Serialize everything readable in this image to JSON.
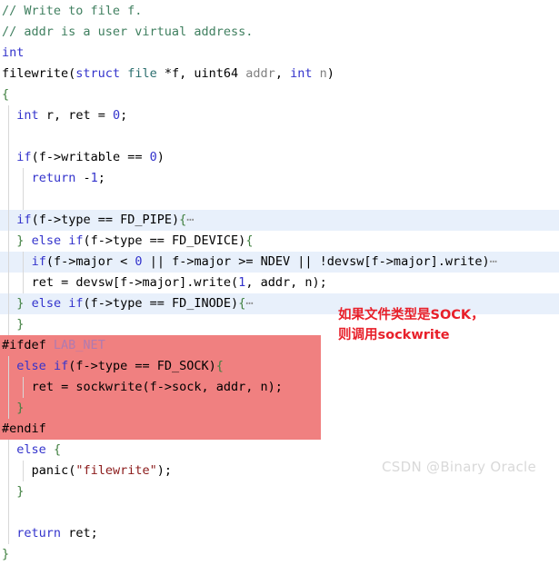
{
  "editor": {
    "language": "c",
    "background": "#ffffff",
    "highlight_row_color": "#e8f0fb",
    "block_highlight_color": "#f08080",
    "lines": [
      {
        "indent": 0,
        "highlight": "none",
        "guides": 0,
        "tokens": [
          {
            "t": "// Write to file f.",
            "c": "t-comment"
          }
        ]
      },
      {
        "indent": 0,
        "highlight": "none",
        "guides": 0,
        "tokens": [
          {
            "t": "// addr is a user virtual address.",
            "c": "t-comment"
          }
        ]
      },
      {
        "indent": 0,
        "highlight": "none",
        "guides": 0,
        "tokens": [
          {
            "t": "int",
            "c": "t-kw"
          }
        ]
      },
      {
        "indent": 0,
        "highlight": "none",
        "guides": 0,
        "tokens": [
          {
            "t": "filewrite",
            "c": "t-plain"
          },
          {
            "t": "(",
            "c": "t-punc"
          },
          {
            "t": "struct",
            "c": "t-kw"
          },
          {
            "t": " ",
            "c": "t-plain"
          },
          {
            "t": "file",
            "c": "t-type"
          },
          {
            "t": " *f, ",
            "c": "t-plain"
          },
          {
            "t": "uint64",
            "c": "t-plain"
          },
          {
            "t": " ",
            "c": "t-plain"
          },
          {
            "t": "addr",
            "c": "t-param"
          },
          {
            "t": ", ",
            "c": "t-plain"
          },
          {
            "t": "int",
            "c": "t-kw"
          },
          {
            "t": " ",
            "c": "t-plain"
          },
          {
            "t": "n",
            "c": "t-param"
          },
          {
            "t": ")",
            "c": "t-punc"
          }
        ]
      },
      {
        "indent": 0,
        "highlight": "none",
        "guides": 0,
        "tokens": [
          {
            "t": "{",
            "c": "t-brace"
          }
        ]
      },
      {
        "indent": 1,
        "highlight": "none",
        "guides": 1,
        "tokens": [
          {
            "t": "int",
            "c": "t-kw"
          },
          {
            "t": " r, ret = ",
            "c": "t-plain"
          },
          {
            "t": "0",
            "c": "t-num"
          },
          {
            "t": ";",
            "c": "t-plain"
          }
        ]
      },
      {
        "indent": 1,
        "highlight": "none",
        "guides": 1,
        "tokens": []
      },
      {
        "indent": 1,
        "highlight": "none",
        "guides": 1,
        "tokens": [
          {
            "t": "if",
            "c": "t-kw"
          },
          {
            "t": "(f->writable == ",
            "c": "t-plain"
          },
          {
            "t": "0",
            "c": "t-num"
          },
          {
            "t": ")",
            "c": "t-plain"
          }
        ]
      },
      {
        "indent": 2,
        "highlight": "none",
        "guides": 2,
        "tokens": [
          {
            "t": "return",
            "c": "t-kw"
          },
          {
            "t": " -",
            "c": "t-plain"
          },
          {
            "t": "1",
            "c": "t-num"
          },
          {
            "t": ";",
            "c": "t-plain"
          }
        ]
      },
      {
        "indent": 1,
        "highlight": "none",
        "guides": 2,
        "tokens": []
      },
      {
        "indent": 1,
        "highlight": "blue",
        "guides": 1,
        "tokens": [
          {
            "t": "if",
            "c": "t-kw"
          },
          {
            "t": "(f->type == FD_PIPE)",
            "c": "t-plain"
          },
          {
            "t": "{",
            "c": "t-brace"
          },
          {
            "t": "⋯",
            "c": "t-fold"
          }
        ]
      },
      {
        "indent": 1,
        "highlight": "none",
        "guides": 1,
        "tokens": [
          {
            "t": "}",
            "c": "t-brace"
          },
          {
            "t": " ",
            "c": "t-plain"
          },
          {
            "t": "else",
            "c": "t-kw"
          },
          {
            "t": " ",
            "c": "t-plain"
          },
          {
            "t": "if",
            "c": "t-kw"
          },
          {
            "t": "(f->type == FD_DEVICE)",
            "c": "t-plain"
          },
          {
            "t": "{",
            "c": "t-brace"
          }
        ]
      },
      {
        "indent": 2,
        "highlight": "blue",
        "guides": 2,
        "tokens": [
          {
            "t": "if",
            "c": "t-kw"
          },
          {
            "t": "(f->major < ",
            "c": "t-plain"
          },
          {
            "t": "0",
            "c": "t-num"
          },
          {
            "t": " ",
            "c": "t-plain"
          },
          {
            "t": "||",
            "c": "t-plain"
          },
          {
            "t": " f->major >= NDEV ",
            "c": "t-plain"
          },
          {
            "t": "||",
            "c": "t-plain"
          },
          {
            "t": " !devsw[f->major].write)",
            "c": "t-plain"
          },
          {
            "t": "⋯",
            "c": "t-fold"
          }
        ]
      },
      {
        "indent": 2,
        "highlight": "none",
        "guides": 2,
        "tokens": [
          {
            "t": "ret = devsw[f->major].write(",
            "c": "t-plain"
          },
          {
            "t": "1",
            "c": "t-num"
          },
          {
            "t": ", ",
            "c": "t-plain"
          },
          {
            "t": "addr",
            "c": "t-plain"
          },
          {
            "t": ", n);",
            "c": "t-plain"
          }
        ]
      },
      {
        "indent": 1,
        "highlight": "blue",
        "guides": 1,
        "tokens": [
          {
            "t": "}",
            "c": "t-brace"
          },
          {
            "t": " ",
            "c": "t-plain"
          },
          {
            "t": "else",
            "c": "t-kw"
          },
          {
            "t": " ",
            "c": "t-plain"
          },
          {
            "t": "if",
            "c": "t-kw"
          },
          {
            "t": "(f->type == FD_INODE)",
            "c": "t-plain"
          },
          {
            "t": "{",
            "c": "t-brace"
          },
          {
            "t": "⋯",
            "c": "t-fold"
          }
        ]
      },
      {
        "indent": 1,
        "highlight": "none",
        "guides": 1,
        "tokens": [
          {
            "t": "}",
            "c": "t-brace"
          }
        ]
      },
      {
        "indent": 0,
        "highlight": "pink",
        "guides": 0,
        "tokens": [
          {
            "t": "#ifdef",
            "c": "t-macro"
          },
          {
            "t": " ",
            "c": "t-plain"
          },
          {
            "t": "LAB_NET",
            "c": "t-macroid"
          }
        ]
      },
      {
        "indent": 1,
        "highlight": "pink",
        "guides": 1,
        "tokens": [
          {
            "t": "else",
            "c": "t-kw"
          },
          {
            "t": " ",
            "c": "t-plain"
          },
          {
            "t": "if",
            "c": "t-kw"
          },
          {
            "t": "(f->type == FD_SOCK)",
            "c": "t-plain"
          },
          {
            "t": "{",
            "c": "t-brace"
          }
        ]
      },
      {
        "indent": 2,
        "highlight": "pink",
        "guides": 2,
        "tokens": [
          {
            "t": "ret = sockwrite(f->sock, addr, n);",
            "c": "t-plain"
          }
        ]
      },
      {
        "indent": 1,
        "highlight": "pink",
        "guides": 1,
        "tokens": [
          {
            "t": "}",
            "c": "t-brace"
          }
        ]
      },
      {
        "indent": 0,
        "highlight": "pink",
        "guides": 0,
        "tokens": [
          {
            "t": "#endif",
            "c": "t-macro"
          }
        ]
      },
      {
        "indent": 1,
        "highlight": "none",
        "guides": 1,
        "tokens": [
          {
            "t": "else",
            "c": "t-kw"
          },
          {
            "t": " ",
            "c": "t-plain"
          },
          {
            "t": "{",
            "c": "t-brace"
          }
        ]
      },
      {
        "indent": 2,
        "highlight": "none",
        "guides": 2,
        "tokens": [
          {
            "t": "panic(",
            "c": "t-plain"
          },
          {
            "t": "\"filewrite\"",
            "c": "t-str"
          },
          {
            "t": ");",
            "c": "t-plain"
          }
        ]
      },
      {
        "indent": 1,
        "highlight": "none",
        "guides": 1,
        "tokens": [
          {
            "t": "}",
            "c": "t-brace"
          }
        ]
      },
      {
        "indent": 1,
        "highlight": "none",
        "guides": 1,
        "tokens": []
      },
      {
        "indent": 1,
        "highlight": "none",
        "guides": 1,
        "tokens": [
          {
            "t": "return",
            "c": "t-kw"
          },
          {
            "t": " ret;",
            "c": "t-plain"
          }
        ]
      },
      {
        "indent": 0,
        "highlight": "none",
        "guides": 0,
        "tokens": [
          {
            "t": "}",
            "c": "t-brace"
          }
        ]
      }
    ]
  },
  "annotation": {
    "text": "如果文件类型是SOCK，\n则调用sockwrite",
    "color": "#e8202a"
  },
  "watermark": {
    "text": "CSDN @Binary Oracle",
    "color": "#d9d9d9"
  }
}
